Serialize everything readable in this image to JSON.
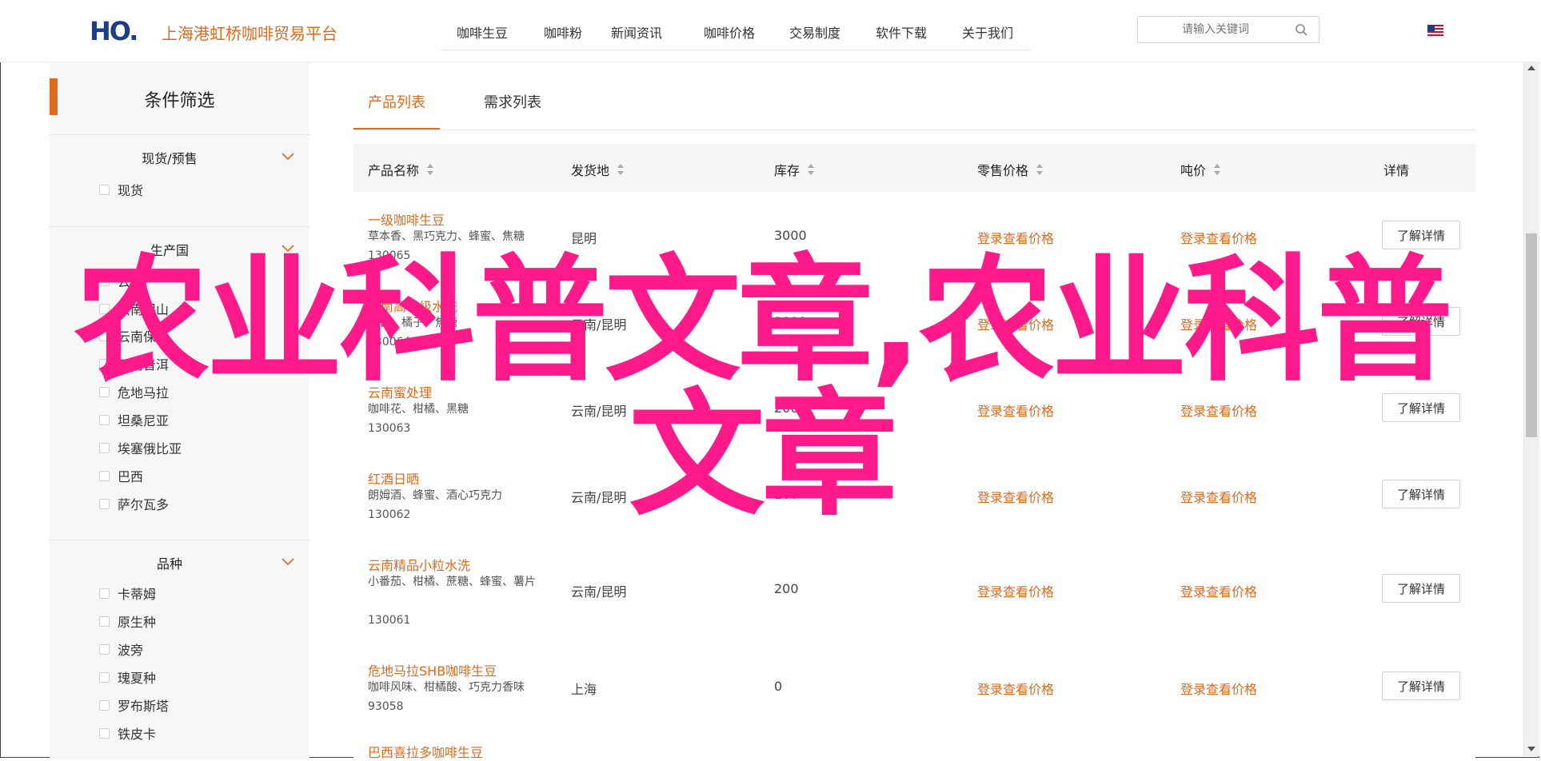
{
  "header": {
    "logo_text": "HO.",
    "site_title": "上海港虹桥咖啡贸易平台",
    "nav": [
      "咖啡生豆",
      "咖啡粉",
      "新闻资讯",
      "咖啡价格",
      "交易制度",
      "软件下载",
      "关于我们"
    ],
    "search_placeholder": "请输入关键词"
  },
  "sidebar": {
    "title": "条件筛选",
    "groups": [
      {
        "title": "现货/预售",
        "items": [
          "现货"
        ]
      },
      {
        "title": "生产国",
        "items": [
          "云南",
          "云南保山",
          "云南保山",
          "云南普洱",
          "危地马拉",
          "坦桑尼亚",
          "埃塞俄比亚",
          "巴西",
          "萨尔瓦多"
        ]
      },
      {
        "title": "品种",
        "items": [
          "卡蒂姆",
          "原生种",
          "波旁",
          "瑰夏种",
          "罗布斯塔",
          "铁皮卡"
        ]
      }
    ]
  },
  "tabs": [
    "产品列表",
    "需求列表"
  ],
  "table": {
    "headers": [
      "产品名称",
      "发货地",
      "库存",
      "零售价格",
      "吨价",
      "详情"
    ],
    "rows": [
      {
        "name": "一级咖啡生豆",
        "desc": "草本香、黑巧克力、蜂蜜、焦糖",
        "code": "130065",
        "origin": "昆明",
        "stock": "3000",
        "retail": "登录查看价格",
        "ton": "登录查看价格",
        "btn": "了解详情"
      },
      {
        "name": "云南高一级水洗",
        "desc": "花香、橘子、焦糖",
        "code": "130064",
        "origin": "云南/昆明",
        "stock": "3000",
        "retail": "登录查看价格",
        "ton": "登录查看价格",
        "btn": "了解详情"
      },
      {
        "name": "云南蜜处理",
        "desc": "咖啡花、柑橘、黑糖",
        "code": "130063",
        "origin": "云南/昆明",
        "stock": "200",
        "retail": "登录查看价格",
        "ton": "登录查看价格",
        "btn": "了解详情"
      },
      {
        "name": "红酒日晒",
        "desc": "朗姆酒、蜂蜜、酒心巧克力",
        "code": "130062",
        "origin": "云南/昆明",
        "stock": "200",
        "retail": "登录查看价格",
        "ton": "登录查看价格",
        "btn": "了解详情"
      },
      {
        "name": "云南精品小粒水洗",
        "desc": "小番茄、柑橘、蔗糖、蜂蜜、薯片",
        "code": "130061",
        "origin": "云南/昆明",
        "stock": "200",
        "retail": "登录查看价格",
        "ton": "登录查看价格",
        "btn": "了解详情"
      },
      {
        "name": "危地马拉SHB咖啡生豆",
        "desc": "咖啡风味、柑橘酸、巧克力香味",
        "code": "93058",
        "origin": "上海",
        "stock": "0",
        "retail": "登录查看价格",
        "ton": "登录查看价格",
        "btn": "了解详情"
      },
      {
        "name": "巴西喜拉多咖啡生豆",
        "desc": "",
        "code": "",
        "origin": "",
        "stock": "",
        "retail": "",
        "ton": "",
        "btn": ""
      }
    ]
  },
  "watermark": [
    "农业科普文章,农业科普",
    "文章"
  ],
  "colors": {
    "accent": "#e06a1c",
    "watermark": "#ff1a8c",
    "logo": "#1c3d8a"
  }
}
